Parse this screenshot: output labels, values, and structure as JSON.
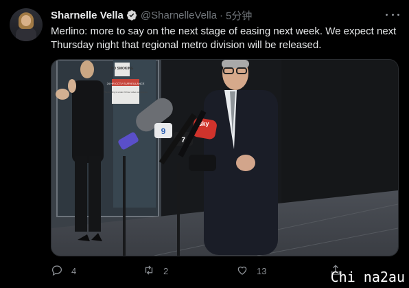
{
  "author": {
    "name": "Sharnelle Vella",
    "handle": "@SharnelleVella",
    "separator": "·",
    "time": "5分钟"
  },
  "tweet": {
    "text": "Merlino: more to say on the next stage of easing next week. We expect next Thursday night that regional metro division will be released."
  },
  "media": {
    "signs": [
      "NO SMOKING",
      "24 HR CCTV SURVEILLANCE",
      "This building is under 24 hour video surveillance"
    ],
    "mic_flag_1": "9",
    "mic_flag_2": "7",
    "mic_flag_3": "sky"
  },
  "actions": {
    "reply_count": "4",
    "retweet_count": "2",
    "like_count": "13"
  },
  "icons": [
    "verified-icon",
    "more-icon",
    "reply-icon",
    "retweet-icon",
    "like-icon",
    "share-icon"
  ],
  "watermark": "Chi na2au",
  "colors": {
    "background": "#000000",
    "verified": "#d9d9d9",
    "text": "#e7e9ea",
    "muted": "#71767b"
  }
}
